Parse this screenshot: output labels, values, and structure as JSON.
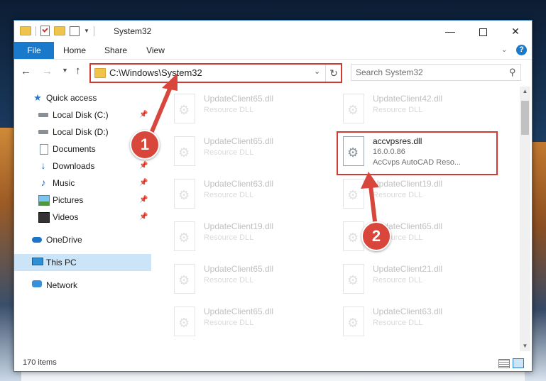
{
  "window": {
    "title": "System32",
    "controls": {
      "minimize": "—",
      "maximize": "",
      "close": "✕"
    }
  },
  "ribbon": {
    "tabs": [
      "File",
      "Home",
      "Share",
      "View"
    ],
    "help": "?"
  },
  "address": {
    "path": "C:\\Windows\\System32",
    "search_placeholder": "Search System32"
  },
  "nav": {
    "items": [
      {
        "label": "Quick access",
        "icon": "star-icon"
      },
      {
        "label": "Local Disk (C:)",
        "icon": "drive-icon",
        "pinned": true
      },
      {
        "label": "Local Disk (D:)",
        "icon": "drive-icon"
      },
      {
        "label": "Documents",
        "icon": "documents-icon",
        "pinned": true
      },
      {
        "label": "Downloads",
        "icon": "downloads-icon",
        "pinned": true
      },
      {
        "label": "Music",
        "icon": "music-icon",
        "pinned": true
      },
      {
        "label": "Pictures",
        "icon": "pictures-icon",
        "pinned": true
      },
      {
        "label": "Videos",
        "icon": "videos-icon",
        "pinned": true
      },
      {
        "label": "OneDrive",
        "icon": "onedrive-icon"
      },
      {
        "label": "This PC",
        "icon": "pc-icon",
        "selected": true
      },
      {
        "label": "Network",
        "icon": "network-icon"
      }
    ]
  },
  "files": {
    "left": [
      {
        "name": "UpdateClient65.dll",
        "type": "Resource DLL"
      },
      {
        "name": "UpdateClient65.dll",
        "type": "Resource DLL"
      },
      {
        "name": "UpdateClient63.dll",
        "type": "Resource DLL"
      },
      {
        "name": "UpdateClient19.dll",
        "type": "Resource DLL"
      },
      {
        "name": "UpdateClient65.dll",
        "type": "Resource DLL"
      },
      {
        "name": "UpdateClient65.dll",
        "type": "Resource DLL"
      }
    ],
    "right": [
      {
        "name": "UpdateClient42.dll",
        "type": "Resource DLL"
      },
      {
        "name": "UpdateClient19.dll",
        "type": "Resource DLL"
      },
      {
        "name": "UpdateClient65.dll",
        "type": "Resource DLL"
      },
      {
        "name": "UpdateClient21.dll",
        "type": "Resource DLL"
      },
      {
        "name": "UpdateClient63.dll",
        "type": "Resource DLL"
      }
    ],
    "highlighted": {
      "name": "accvpsres.dll",
      "version": "16.0.0.86",
      "description": "AcCvps AutoCAD Reso..."
    }
  },
  "status": {
    "items": "170 items"
  },
  "annotations": {
    "step1": "1",
    "step2": "2",
    "color": "#d9463c"
  }
}
